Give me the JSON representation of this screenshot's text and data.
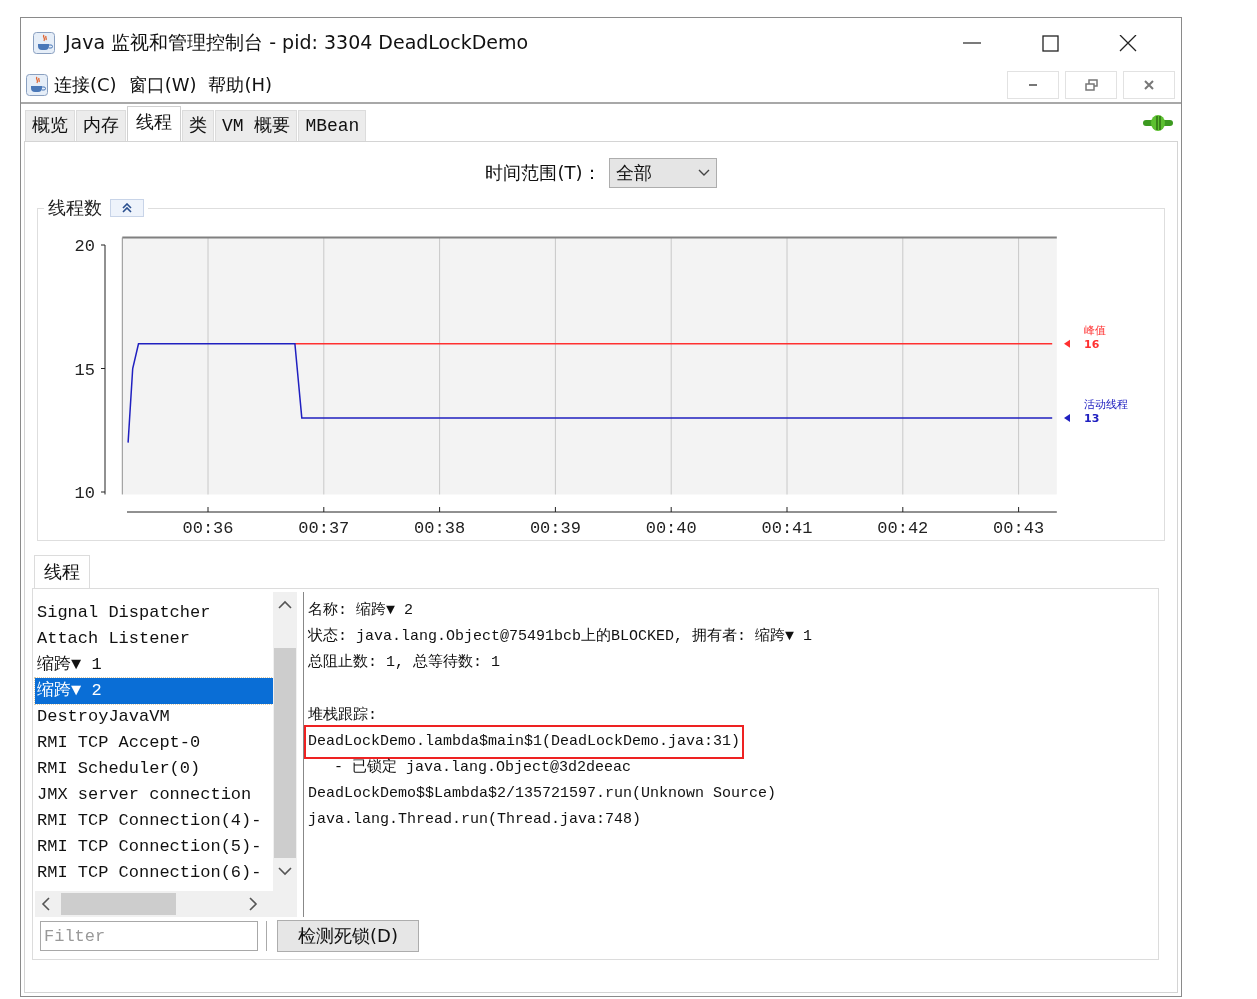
{
  "window": {
    "title": "Java 监视和管理控制台 - pid: 3304 DeadLockDemo"
  },
  "menu_bar": {
    "items": [
      {
        "label": "连接(C)"
      },
      {
        "label": "窗口(W)"
      },
      {
        "label": "帮助(H)"
      }
    ]
  },
  "tabs": [
    {
      "label": "概览",
      "selected": false
    },
    {
      "label": "内存",
      "selected": false
    },
    {
      "label": "线程",
      "selected": true
    },
    {
      "label": "类",
      "selected": false
    },
    {
      "label": "VM 概要",
      "selected": false
    },
    {
      "label": "MBean",
      "selected": false
    }
  ],
  "time_range": {
    "label": "时间范围(T)：",
    "value": "全部"
  },
  "thread_chart": {
    "title": "线程数",
    "chart_data": {
      "type": "line",
      "x": [
        35.31,
        35.35,
        35.4,
        36.75,
        36.81,
        43.29
      ],
      "series": [
        {
          "name": "峰值",
          "color": "#ff3030",
          "values": [
            null,
            null,
            null,
            16,
            16,
            16
          ]
        },
        {
          "name": "活动线程",
          "color": "#2020c0",
          "values": [
            12,
            15,
            16,
            16,
            13,
            13
          ]
        }
      ],
      "xlim": [
        35.26,
        43.33
      ],
      "ylim": [
        9.9,
        20.3
      ],
      "xticks": [
        {
          "value": 36,
          "label": "00:36"
        },
        {
          "value": 37,
          "label": "00:37"
        },
        {
          "value": 38,
          "label": "00:38"
        },
        {
          "value": 39,
          "label": "00:39"
        },
        {
          "value": 40,
          "label": "00:40"
        },
        {
          "value": 41,
          "label": "00:41"
        },
        {
          "value": 42,
          "label": "00:42"
        },
        {
          "value": 43,
          "label": "00:43"
        }
      ],
      "yticks": [
        10,
        15,
        20
      ],
      "grid": true
    },
    "legend": [
      {
        "value": "16"
      },
      {
        "value": "13"
      }
    ]
  },
  "thread_panel": {
    "tab": "线程",
    "threads": [
      {
        "name": "Signal Dispatcher",
        "selected": false
      },
      {
        "name": "Attach Listener",
        "selected": false
      },
      {
        "name": "缩跨▼ 1",
        "selected": false
      },
      {
        "name": "缩跨▼ 2",
        "selected": true
      },
      {
        "name": "DestroyJavaVM",
        "selected": false
      },
      {
        "name": "RMI TCP Accept-0",
        "selected": false
      },
      {
        "name": "RMI Scheduler(0)",
        "selected": false
      },
      {
        "name": "JMX server connection",
        "selected": false
      },
      {
        "name": "RMI TCP Connection(4)-",
        "selected": false
      },
      {
        "name": "RMI TCP Connection(5)-",
        "selected": false
      },
      {
        "name": "RMI TCP Connection(6)-",
        "selected": false
      }
    ],
    "details": [
      "名称: 缩跨▼ 2",
      "状态: java.lang.Object@75491bcb上的BLOCKED, 拥有者: 缩跨▼ 1",
      "总阻止数: 1, 总等待数: 1"
    ],
    "stack_label": "堆栈跟踪:",
    "stack_trace": [
      {
        "text": "DeadLockDemo.lambda$main$1(DeadLockDemo.java:31)",
        "kind": "frame",
        "highlighted": true
      },
      {
        "text": "- 已锁定 java.lang.Object@3d2deeac",
        "kind": "lock",
        "highlighted": false
      },
      {
        "text": "DeadLockDemo$$Lambda$2/135721597.run(Unknown Source)",
        "kind": "frame",
        "highlighted": false
      },
      {
        "text": "java.lang.Thread.run(Thread.java:748)",
        "kind": "frame",
        "highlighted": false
      }
    ],
    "filter": {
      "placeholder": "Filter"
    },
    "detect_button": "检测死锁(D)"
  }
}
